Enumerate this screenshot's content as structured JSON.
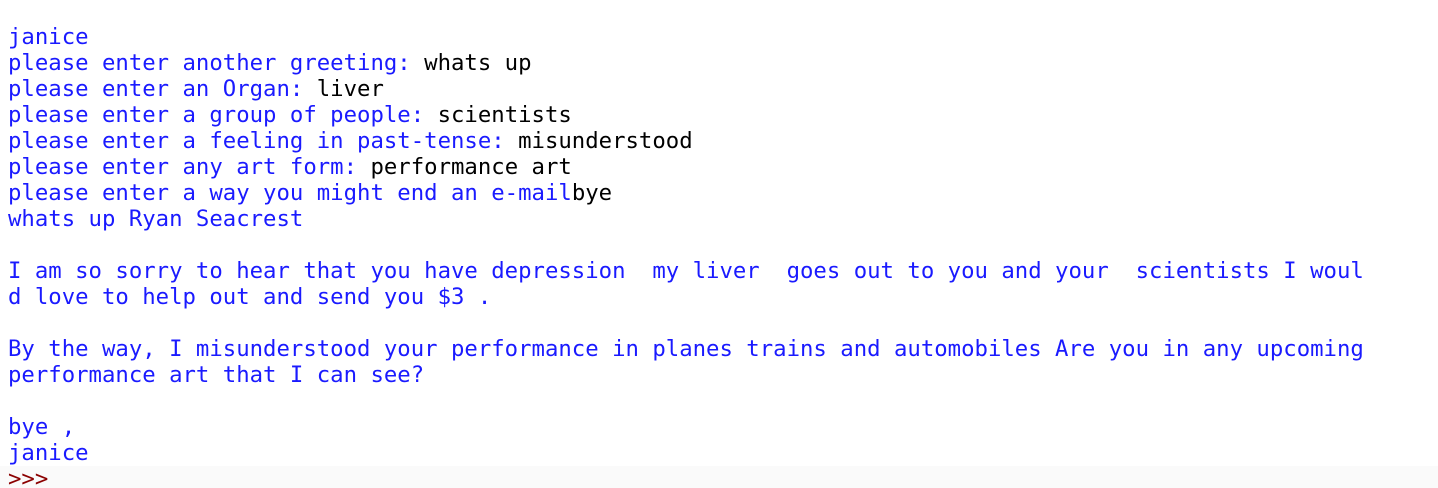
{
  "shell": {
    "lines": {
      "l0": {
        "out": "janice"
      },
      "l1": {
        "out": "please enter another greeting: ",
        "in": "whats up"
      },
      "l2": {
        "out": "please enter an Organ: ",
        "in": "liver"
      },
      "l3": {
        "out": "please enter a group of people: ",
        "in": "scientists"
      },
      "l4": {
        "out": "please enter a feeling in past-tense: ",
        "in": "misunderstood"
      },
      "l5": {
        "out": "please enter any art form: ",
        "in": "performance art"
      },
      "l6": {
        "out": "please enter a way you might end an e-mail",
        "in": "bye"
      },
      "l7": {
        "out": "whats up Ryan Seacrest"
      },
      "l9": {
        "out": "I am so sorry to hear that you have depression  my liver  goes out to you and your  scientists I woul"
      },
      "l10": {
        "out": "d love to help out and send you $3 ."
      },
      "l12": {
        "out": "By the way, I misunderstood your performance in planes trains and automobiles Are you in any upcoming"
      },
      "l13": {
        "out": "performance art that I can see?"
      },
      "l15": {
        "out": "bye ,"
      },
      "l16": {
        "out": "janice"
      }
    },
    "prompt": ">>>",
    "colors": {
      "output": "#1a1aff",
      "input": "#000000",
      "prompt": "#8b0000"
    }
  }
}
